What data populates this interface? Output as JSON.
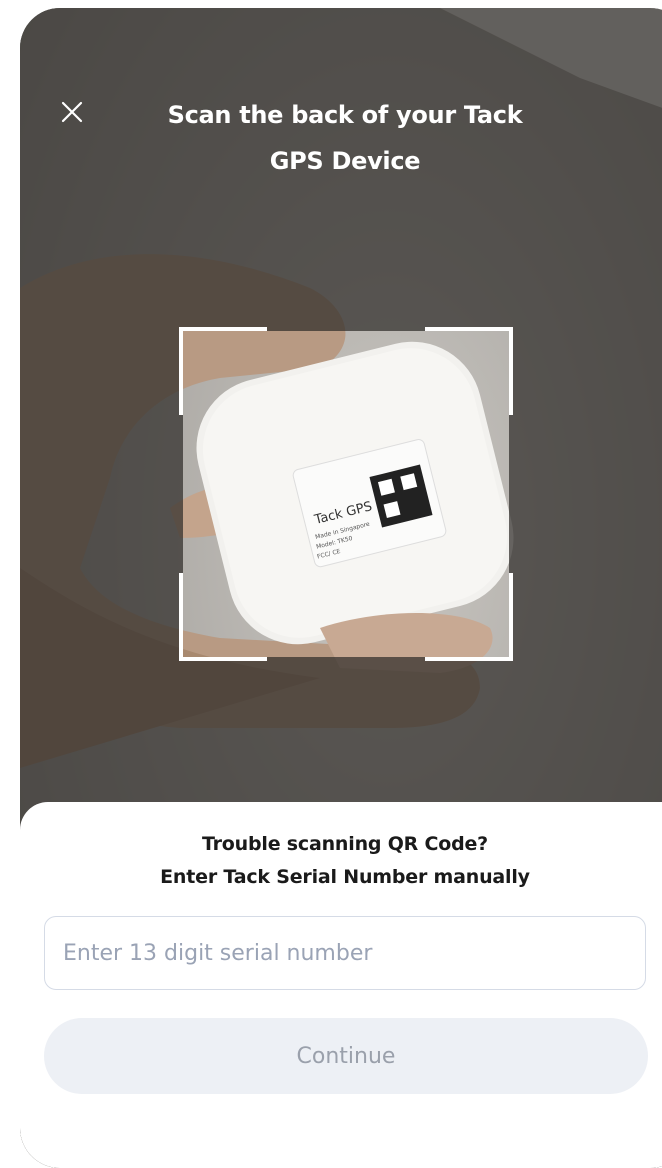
{
  "header": {
    "close_icon": "close-icon",
    "title_line1": "Scan the back of your Tack",
    "title_line2": "GPS Device"
  },
  "device_label": {
    "brand": "Tack GPS",
    "line1": "Made in Singapore",
    "line2": "Model: TK50",
    "line3": "FCC/ CE"
  },
  "sheet": {
    "help_line1": "Trouble scanning QR Code?",
    "help_line2": "Enter Tack Serial Number manually",
    "serial_input": {
      "value": "",
      "placeholder": "Enter 13 digit serial number"
    },
    "continue_label": "Continue"
  },
  "colors": {
    "overlay": "#3d3b38",
    "sheet_bg": "#ffffff",
    "input_border": "#d5dbe6",
    "placeholder": "#9aa3b5",
    "button_bg": "#edf0f5",
    "button_text": "#9aa0ab"
  }
}
